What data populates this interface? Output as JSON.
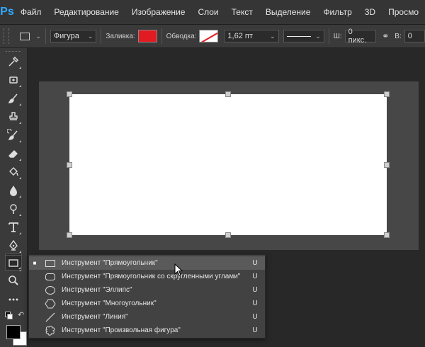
{
  "app": {
    "logo": "Ps"
  },
  "menu": [
    "Файл",
    "Редактирование",
    "Изображение",
    "Слои",
    "Текст",
    "Выделение",
    "Фильтр",
    "3D",
    "Просмо"
  ],
  "options": {
    "mode_value": "Фигура",
    "fill_label": "Заливка:",
    "fill_color": "#e21b22",
    "stroke_label": "Обводка:",
    "stroke_width": "1,62 пт",
    "width_label": "Ш:",
    "width_value": "0 пикс.",
    "height_label": "В:",
    "height_value": "0"
  },
  "flyout": {
    "items": [
      {
        "label": "Инструмент \"Прямоугольник\"",
        "key": "U",
        "icon": "rectangle-icon",
        "selected": true
      },
      {
        "label": "Инструмент \"Прямоугольник со скругленными углами\"",
        "key": "U",
        "icon": "rounded-rectangle-icon",
        "selected": false
      },
      {
        "label": "Инструмент \"Эллипс\"",
        "key": "U",
        "icon": "ellipse-icon",
        "selected": false
      },
      {
        "label": "Инструмент \"Многоугольник\"",
        "key": "U",
        "icon": "polygon-icon",
        "selected": false
      },
      {
        "label": "Инструмент \"Линия\"",
        "key": "U",
        "icon": "line-icon",
        "selected": false
      },
      {
        "label": "Инструмент \"Произвольная фигура\"",
        "key": "U",
        "icon": "custom-shape-icon",
        "selected": false
      }
    ]
  },
  "colors": {
    "foreground": "#000000",
    "background": "#ffffff",
    "accent": "#31a8ff"
  }
}
